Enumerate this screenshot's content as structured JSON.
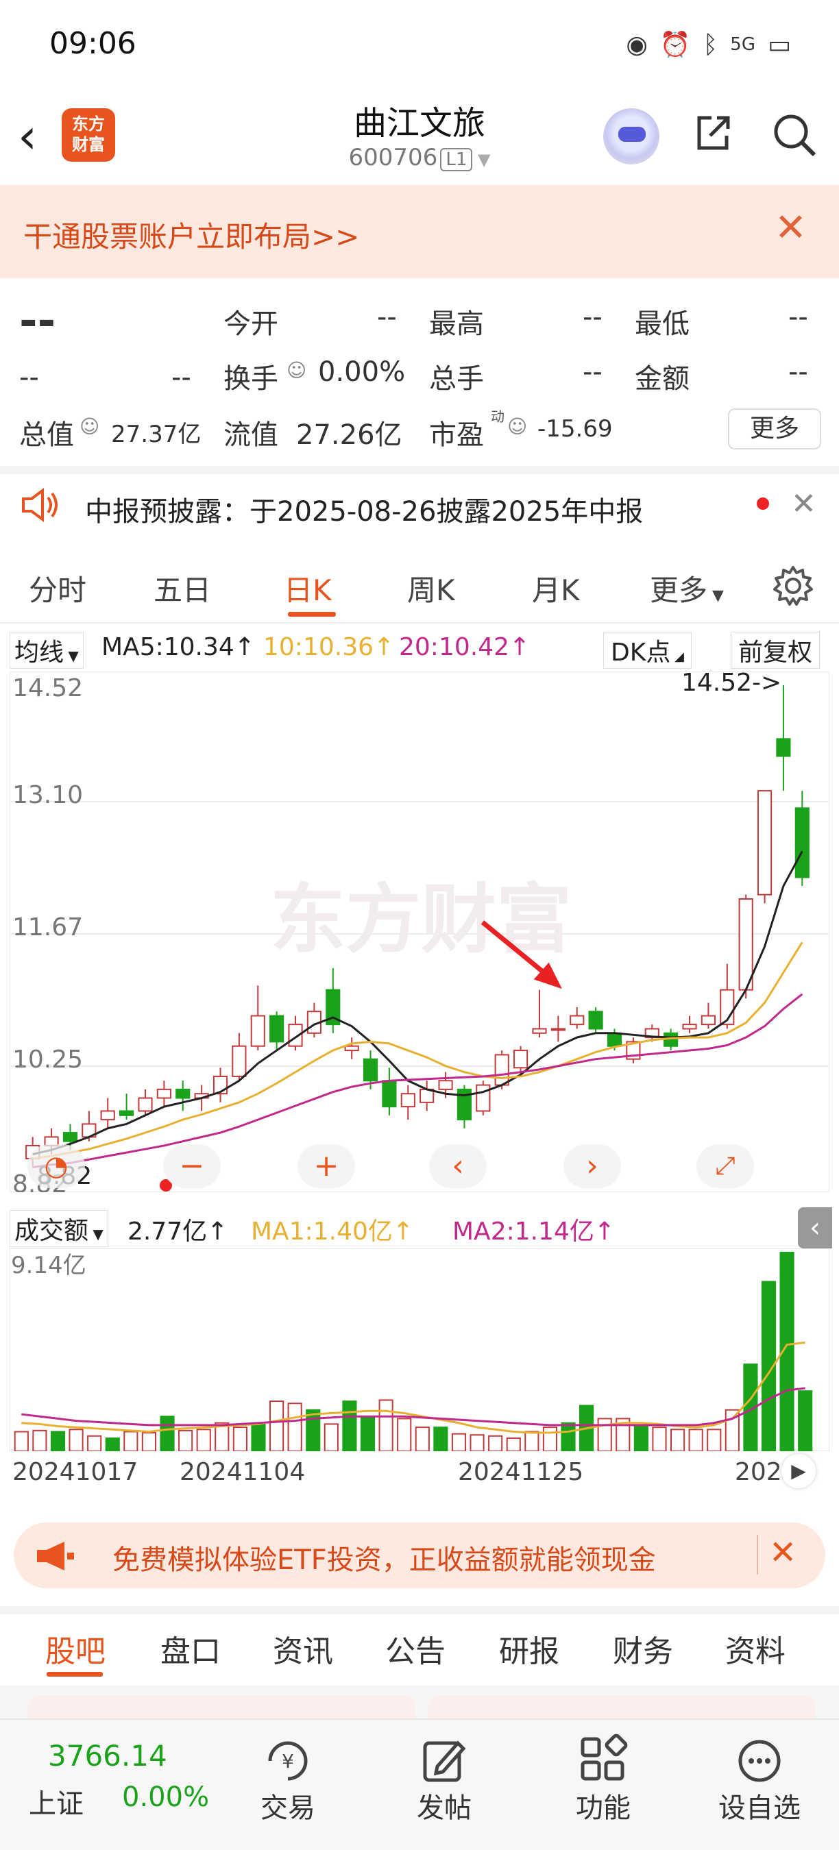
{
  "status": {
    "time": "09:06",
    "signal": "5G",
    "icons": [
      "eye-icon",
      "alarm-icon",
      "bluetooth-icon",
      "signal-icon",
      "battery-icon"
    ]
  },
  "header": {
    "logo_line1": "东方",
    "logo_line2": "财富",
    "title": "曲江文旅",
    "code": "600706",
    "level": "L1"
  },
  "banner": {
    "text": "干通股票账户立即布局>>"
  },
  "quote": {
    "price": "--",
    "change": "--",
    "change_pct": "--",
    "open_label": "今开",
    "open_value": "--",
    "high_label": "最高",
    "high_value": "--",
    "low_label": "最低",
    "low_value": "--",
    "turnover_label": "换手",
    "turnover_value": "0.00%",
    "volume_label": "总手",
    "volume_value": "--",
    "amount_label": "金额",
    "amount_value": "--",
    "mcap_label": "总值",
    "mcap_value": "27.37亿",
    "float_label": "流值",
    "float_value": "27.26亿",
    "pe_label": "市盈",
    "pe_sup": "动",
    "pe_value": "-15.69",
    "more_label": "更多"
  },
  "notice": {
    "text": "中报预披露：于2025-08-26披露2025年中报"
  },
  "tabs": [
    "分时",
    "五日",
    "日K",
    "周K",
    "月K",
    "更多"
  ],
  "ma": {
    "selector": "均线",
    "ma5": "MA5:10.34↑",
    "ma10": "10:10.36↑",
    "ma20": "20:10.42↑",
    "dk": "DK点",
    "adjust": "前复权"
  },
  "volume": {
    "selector": "成交额",
    "value": "2.77亿↑",
    "ma1": "MA1:1.40亿↑",
    "ma2": "MA2:1.14亿↑",
    "max_label": "9.14亿"
  },
  "dates": [
    "20241017",
    "20241104",
    "20241125",
    "202"
  ],
  "ad": {
    "text": "免费模拟体验ETF投资，正收益额就能领现金"
  },
  "bottom_tabs": [
    "股吧",
    "盘口",
    "资讯",
    "公告",
    "研报",
    "财务",
    "资料"
  ],
  "nav": {
    "index_value": "3766.14",
    "index_name": "上证",
    "index_change": "0.00%",
    "items": [
      "交易",
      "发帖",
      "功能",
      "设自选"
    ]
  },
  "colors": {
    "up": "#c43a3a",
    "down": "#1aa31a",
    "ma5": "#222222",
    "ma10": "#e8b030",
    "ma20": "#c0288a",
    "accent": "#e8541e"
  },
  "chart_data": {
    "type": "candlestick",
    "y_ticks": [
      "14.52",
      "13.10",
      "11.67",
      "10.25",
      "8.82"
    ],
    "ylim": [
      8.82,
      14.52
    ],
    "max_label": "14.52->",
    "min_label": "8.82",
    "candles": [
      {
        "o": 9.05,
        "c": 9.2,
        "h": 9.3,
        "l": 8.95
      },
      {
        "o": 9.2,
        "c": 9.3,
        "h": 9.4,
        "l": 9.1
      },
      {
        "o": 9.35,
        "c": 9.25,
        "h": 9.45,
        "l": 9.15
      },
      {
        "o": 9.3,
        "c": 9.45,
        "h": 9.6,
        "l": 9.25
      },
      {
        "o": 9.5,
        "c": 9.6,
        "h": 9.75,
        "l": 9.4
      },
      {
        "o": 9.6,
        "c": 9.55,
        "h": 9.8,
        "l": 9.5
      },
      {
        "o": 9.6,
        "c": 9.75,
        "h": 9.85,
        "l": 9.55
      },
      {
        "o": 9.75,
        "c": 9.85,
        "h": 9.95,
        "l": 9.65
      },
      {
        "o": 9.85,
        "c": 9.75,
        "h": 9.95,
        "l": 9.6
      },
      {
        "o": 9.75,
        "c": 9.8,
        "h": 9.9,
        "l": 9.6
      },
      {
        "o": 9.8,
        "c": 10.0,
        "h": 10.1,
        "l": 9.7
      },
      {
        "o": 10.0,
        "c": 10.35,
        "h": 10.5,
        "l": 9.95
      },
      {
        "o": 10.35,
        "c": 10.7,
        "h": 11.05,
        "l": 10.3
      },
      {
        "o": 10.7,
        "c": 10.4,
        "h": 10.75,
        "l": 10.3
      },
      {
        "o": 10.35,
        "c": 10.6,
        "h": 10.7,
        "l": 10.3
      },
      {
        "o": 10.5,
        "c": 10.75,
        "h": 10.85,
        "l": 10.45
      },
      {
        "o": 11.0,
        "c": 10.6,
        "h": 11.25,
        "l": 10.5
      },
      {
        "o": 10.3,
        "c": 10.35,
        "h": 10.45,
        "l": 10.2
      },
      {
        "o": 10.2,
        "c": 9.95,
        "h": 10.3,
        "l": 9.85
      },
      {
        "o": 9.95,
        "c": 9.65,
        "h": 10.1,
        "l": 9.55
      },
      {
        "o": 9.65,
        "c": 9.8,
        "h": 9.9,
        "l": 9.5
      },
      {
        "o": 9.7,
        "c": 9.85,
        "h": 9.95,
        "l": 9.6
      },
      {
        "o": 9.85,
        "c": 9.95,
        "h": 10.05,
        "l": 9.75
      },
      {
        "o": 9.85,
        "c": 9.5,
        "h": 9.9,
        "l": 9.4
      },
      {
        "o": 9.6,
        "c": 9.9,
        "h": 9.95,
        "l": 9.55
      },
      {
        "o": 9.9,
        "c": 10.25,
        "h": 10.3,
        "l": 9.85
      },
      {
        "o": 10.1,
        "c": 10.3,
        "h": 10.35,
        "l": 10.0
      },
      {
        "o": 10.5,
        "c": 10.55,
        "h": 11.0,
        "l": 10.45
      },
      {
        "o": 10.55,
        "c": 10.55,
        "h": 10.7,
        "l": 10.4
      },
      {
        "o": 10.6,
        "c": 10.7,
        "h": 10.8,
        "l": 10.55
      },
      {
        "o": 10.75,
        "c": 10.55,
        "h": 10.8,
        "l": 10.5
      },
      {
        "o": 10.5,
        "c": 10.35,
        "h": 10.55,
        "l": 10.3
      },
      {
        "o": 10.2,
        "c": 10.4,
        "h": 10.45,
        "l": 10.15
      },
      {
        "o": 10.45,
        "c": 10.55,
        "h": 10.6,
        "l": 10.4
      },
      {
        "o": 10.5,
        "c": 10.35,
        "h": 10.55,
        "l": 10.3
      },
      {
        "o": 10.55,
        "c": 10.6,
        "h": 10.7,
        "l": 10.5
      },
      {
        "o": 10.6,
        "c": 10.7,
        "h": 10.85,
        "l": 10.55
      },
      {
        "o": 10.6,
        "c": 11.0,
        "h": 11.3,
        "l": 10.55
      },
      {
        "o": 11.0,
        "c": 12.05,
        "h": 12.1,
        "l": 10.9
      },
      {
        "o": 12.1,
        "c": 13.3,
        "h": 13.3,
        "l": 12.0
      },
      {
        "o": 13.9,
        "c": 13.7,
        "h": 14.52,
        "l": 13.3
      },
      {
        "o": 13.1,
        "c": 12.3,
        "h": 13.3,
        "l": 12.2
      }
    ],
    "ma5": [
      9.1,
      9.15,
      9.22,
      9.3,
      9.4,
      9.45,
      9.55,
      9.65,
      9.7,
      9.75,
      9.82,
      9.95,
      10.15,
      10.3,
      10.45,
      10.6,
      10.68,
      10.58,
      10.4,
      10.18,
      9.95,
      9.85,
      9.8,
      9.78,
      9.82,
      9.9,
      10.02,
      10.2,
      10.35,
      10.45,
      10.5,
      10.5,
      10.48,
      10.46,
      10.45,
      10.46,
      10.5,
      10.65,
      11.0,
      11.5,
      12.2,
      12.6
    ],
    "ma10": [
      9.05,
      9.08,
      9.12,
      9.16,
      9.22,
      9.28,
      9.35,
      9.42,
      9.5,
      9.56,
      9.63,
      9.7,
      9.8,
      9.92,
      10.05,
      10.18,
      10.3,
      10.38,
      10.4,
      10.38,
      10.3,
      10.22,
      10.12,
      10.05,
      10.0,
      9.98,
      10.0,
      10.05,
      10.12,
      10.2,
      10.28,
      10.34,
      10.38,
      10.42,
      10.44,
      10.45,
      10.45,
      10.5,
      10.62,
      10.85,
      11.2,
      11.55
    ],
    "ma20": [
      8.95,
      8.98,
      9.0,
      9.04,
      9.08,
      9.12,
      9.16,
      9.2,
      9.25,
      9.3,
      9.35,
      9.42,
      9.5,
      9.58,
      9.66,
      9.74,
      9.82,
      9.88,
      9.92,
      9.95,
      9.96,
      9.97,
      9.98,
      9.99,
      10.0,
      10.02,
      10.05,
      10.08,
      10.12,
      10.16,
      10.2,
      10.22,
      10.24,
      10.26,
      10.28,
      10.3,
      10.32,
      10.36,
      10.45,
      10.58,
      10.78,
      10.95
    ],
    "volume": [
      0.9,
      0.95,
      0.9,
      1.0,
      0.7,
      0.6,
      0.9,
      0.85,
      1.6,
      0.95,
      1.0,
      1.3,
      1.1,
      1.3,
      2.3,
      2.2,
      1.9,
      1.25,
      2.3,
      1.6,
      2.35,
      1.5,
      1.1,
      1.1,
      0.8,
      0.75,
      0.7,
      0.6,
      0.9,
      1.1,
      1.3,
      2.1,
      1.5,
      1.5,
      1.2,
      1.1,
      1.0,
      1.0,
      1.0,
      1.9,
      4.0,
      7.8,
      9.14,
      2.77
    ],
    "vol_ma1": [
      1.3,
      1.25,
      1.15,
      1.1,
      1.05,
      1.0,
      0.95,
      0.9,
      1.0,
      1.05,
      1.1,
      1.15,
      1.2,
      1.25,
      1.4,
      1.55,
      1.7,
      1.75,
      1.8,
      1.85,
      1.85,
      1.75,
      1.6,
      1.45,
      1.3,
      1.1,
      1.0,
      0.9,
      0.85,
      0.85,
      0.9,
      1.05,
      1.2,
      1.3,
      1.3,
      1.25,
      1.15,
      1.1,
      1.2,
      1.5,
      2.4,
      3.6,
      4.9,
      5.0
    ],
    "vol_ma2": [
      1.7,
      1.6,
      1.5,
      1.4,
      1.35,
      1.3,
      1.25,
      1.2,
      1.2,
      1.2,
      1.2,
      1.2,
      1.25,
      1.3,
      1.35,
      1.4,
      1.5,
      1.55,
      1.6,
      1.6,
      1.6,
      1.6,
      1.55,
      1.5,
      1.45,
      1.4,
      1.35,
      1.3,
      1.25,
      1.2,
      1.2,
      1.2,
      1.2,
      1.2,
      1.2,
      1.2,
      1.2,
      1.2,
      1.3,
      1.5,
      1.9,
      2.4,
      2.8,
      2.9
    ]
  }
}
